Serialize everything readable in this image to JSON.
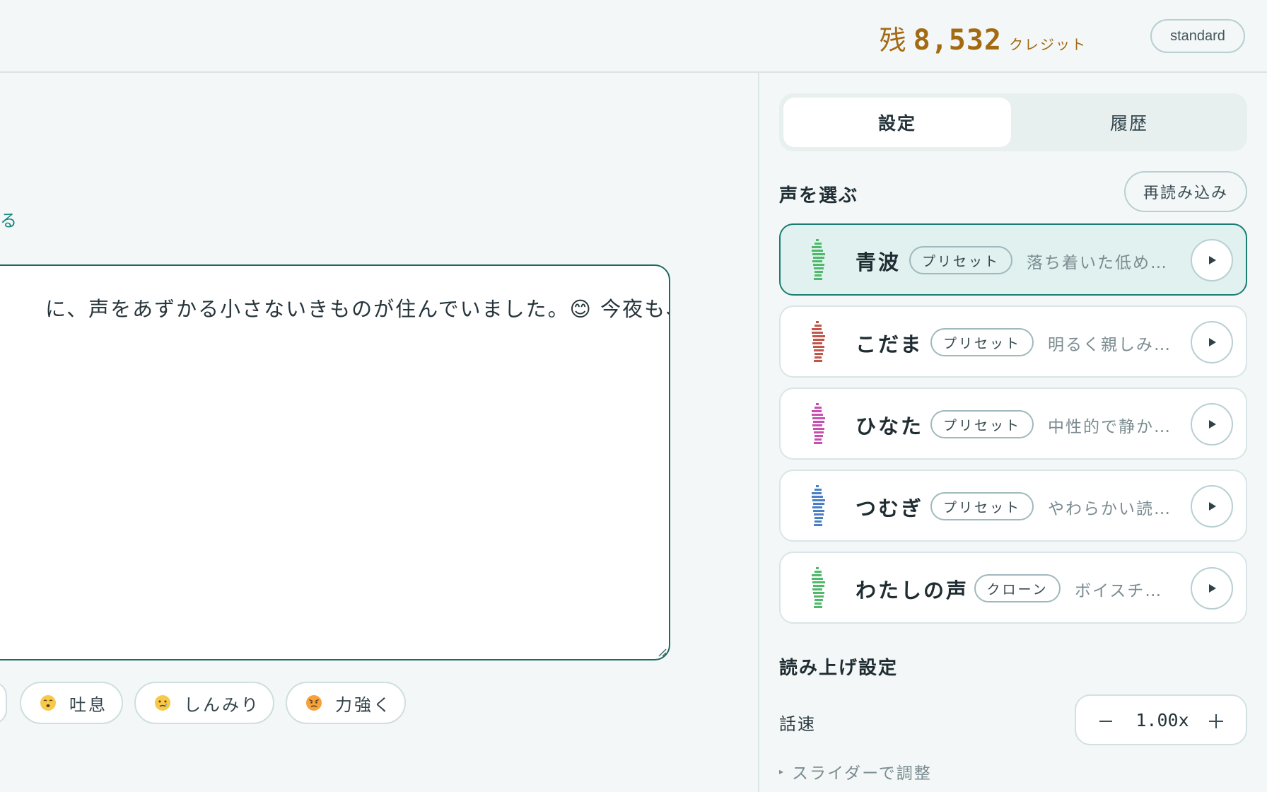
{
  "header": {
    "credits_prefix": "残",
    "credits_value": "8,532",
    "credits_unit": "クレジット",
    "plan_label": "standard"
  },
  "editor": {
    "link_text": "る",
    "text": "に、声をあずかる小さないきものが住んでいました。😊 今夜も、"
  },
  "chips": [
    {
      "label": "吐息",
      "icon": "sigh-face-icon"
    },
    {
      "label": "しんみり",
      "icon": "crying-face-icon"
    },
    {
      "label": "力強く",
      "icon": "angry-face-icon"
    }
  ],
  "panel": {
    "tabs": [
      {
        "label": "設定",
        "active": true
      },
      {
        "label": "履歴",
        "active": false
      }
    ],
    "voice_section_title": "声を選ぶ",
    "reload_label": "再読み込み",
    "voices": [
      {
        "name": "青波",
        "tag": "プリセット",
        "desc": "落ち着いた低め…",
        "color": "#4fb86a",
        "selected": true
      },
      {
        "name": "こだま",
        "tag": "プリセット",
        "desc": "明るく親しみ…",
        "color": "#c0564a",
        "selected": false
      },
      {
        "name": "ひなた",
        "tag": "プリセット",
        "desc": "中性的で静か…",
        "color": "#c64fb0",
        "selected": false
      },
      {
        "name": "つむぎ",
        "tag": "プリセット",
        "desc": "やわらかい読…",
        "color": "#4a7fc4",
        "selected": false
      },
      {
        "name": "わたしの声",
        "tag": "クローン",
        "desc": "ボイスチ…",
        "color": "#4fb86a",
        "selected": false
      }
    ],
    "reading_section_title": "読み上げ設定",
    "speed_label": "話速",
    "speed_value": "1.00x",
    "slider_hint": "スライダーで調整"
  },
  "colors": {
    "accent": "#1b7d72",
    "credits": "#a36a12",
    "selected_bg": "#e0f1ef"
  }
}
